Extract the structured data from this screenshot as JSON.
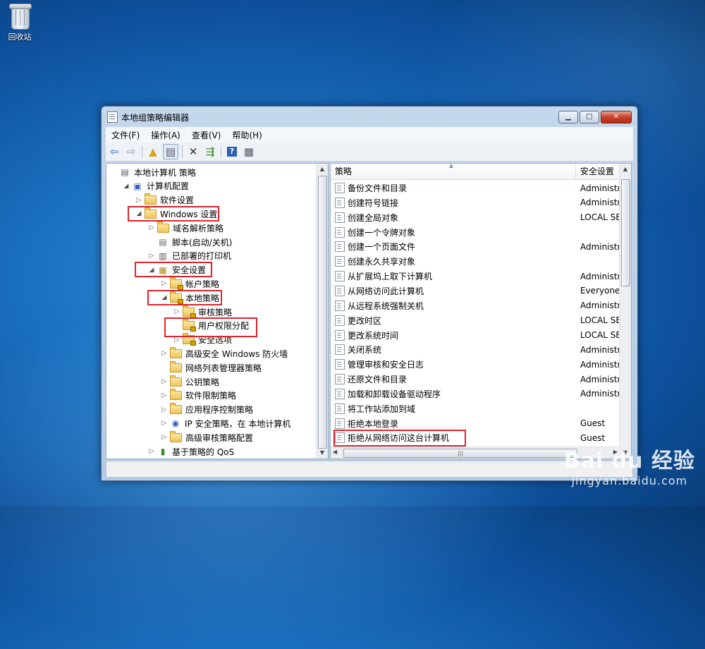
{
  "desktop": {
    "recycle_bin_label": "回收站"
  },
  "window": {
    "title": "本地组策略编辑器",
    "controls": {
      "minimize": "▁",
      "maximize": "□",
      "close": "✕"
    },
    "menu": [
      "文件(F)",
      "操作(A)",
      "查看(V)",
      "帮助(H)"
    ]
  },
  "toolbar": {
    "icons": [
      "back-arrow-icon",
      "forward-arrow-icon",
      "up-folder-icon",
      "show-hide-tree-icon",
      "delete-icon",
      "export-list-icon",
      "help-icon",
      "properties-icon"
    ]
  },
  "tree": [
    {
      "label": "本地计算机 策略",
      "indent": 0,
      "arrow": "",
      "icon": "doc"
    },
    {
      "label": "计算机配置",
      "indent": 1,
      "arrow": "◢",
      "icon": "computer"
    },
    {
      "label": "软件设置",
      "indent": 2,
      "arrow": "▷",
      "icon": "folder"
    },
    {
      "label": "Windows 设置",
      "indent": 2,
      "arrow": "◢",
      "icon": "folder"
    },
    {
      "label": "域名解析策略",
      "indent": 3,
      "arrow": "▷",
      "icon": "folder"
    },
    {
      "label": "脚本(启动/关机)",
      "indent": 3,
      "arrow": "",
      "icon": "script"
    },
    {
      "label": "已部署的打印机",
      "indent": 3,
      "arrow": "▷",
      "icon": "printer"
    },
    {
      "label": "安全设置",
      "indent": 3,
      "arrow": "◢",
      "icon": "security"
    },
    {
      "label": "帐户策略",
      "indent": 4,
      "arrow": "▷",
      "icon": "lockfolder"
    },
    {
      "label": "本地策略",
      "indent": 4,
      "arrow": "◢",
      "icon": "lockfolder"
    },
    {
      "label": "审核策略",
      "indent": 5,
      "arrow": "▷",
      "icon": "lockfolder"
    },
    {
      "label": "用户权限分配",
      "indent": 5,
      "arrow": "",
      "icon": "lockfolder"
    },
    {
      "label": "安全选项",
      "indent": 5,
      "arrow": "▷",
      "icon": "lockfolder"
    },
    {
      "label": "高级安全 Windows 防火墙",
      "indent": 4,
      "arrow": "▷",
      "icon": "folder"
    },
    {
      "label": "网络列表管理器策略",
      "indent": 4,
      "arrow": "",
      "icon": "folder"
    },
    {
      "label": "公钥策略",
      "indent": 4,
      "arrow": "▷",
      "icon": "folder"
    },
    {
      "label": "软件限制策略",
      "indent": 4,
      "arrow": "▷",
      "icon": "folder"
    },
    {
      "label": "应用程序控制策略",
      "indent": 4,
      "arrow": "▷",
      "icon": "folder"
    },
    {
      "label": "IP 安全策略，在 本地计算机",
      "indent": 4,
      "arrow": "▷",
      "icon": "ipsec"
    },
    {
      "label": "高级审核策略配置",
      "indent": 4,
      "arrow": "▷",
      "icon": "folder"
    },
    {
      "label": "基于策略的 QoS",
      "indent": 3,
      "arrow": "▷",
      "icon": "chart"
    }
  ],
  "list": {
    "columns": [
      "策略",
      "安全设置"
    ],
    "sort_indicator": "▲",
    "rows": [
      {
        "policy": "备份文件和目录",
        "setting": "Administrat"
      },
      {
        "policy": "创建符号链接",
        "setting": "Administrat"
      },
      {
        "policy": "创建全局对象",
        "setting": "LOCAL SER"
      },
      {
        "policy": "创建一个令牌对象",
        "setting": ""
      },
      {
        "policy": "创建一个页面文件",
        "setting": "Administrat"
      },
      {
        "policy": "创建永久共享对象",
        "setting": ""
      },
      {
        "policy": "从扩展坞上取下计算机",
        "setting": "Administrat"
      },
      {
        "policy": "从网络访问此计算机",
        "setting": "Everyone,"
      },
      {
        "policy": "从远程系统强制关机",
        "setting": "Administrat"
      },
      {
        "policy": "更改时区",
        "setting": "LOCAL SER"
      },
      {
        "policy": "更改系统时间",
        "setting": "LOCAL SER"
      },
      {
        "policy": "关闭系统",
        "setting": "Administrat"
      },
      {
        "policy": "管理审核和安全日志",
        "setting": "Administrat"
      },
      {
        "policy": "还原文件和目录",
        "setting": "Administrat"
      },
      {
        "policy": "加载和卸载设备驱动程序",
        "setting": "Administrat"
      },
      {
        "policy": "将工作站添加到域",
        "setting": ""
      },
      {
        "policy": "拒绝本地登录",
        "setting": "Guest"
      },
      {
        "policy": "拒绝从网络访问这台计算机",
        "setting": "Guest"
      }
    ]
  },
  "watermark": {
    "line1": "Bai du 经验",
    "line2": "jingyan.baidu.com"
  },
  "colors": {
    "highlight_box": "#e0242c"
  }
}
